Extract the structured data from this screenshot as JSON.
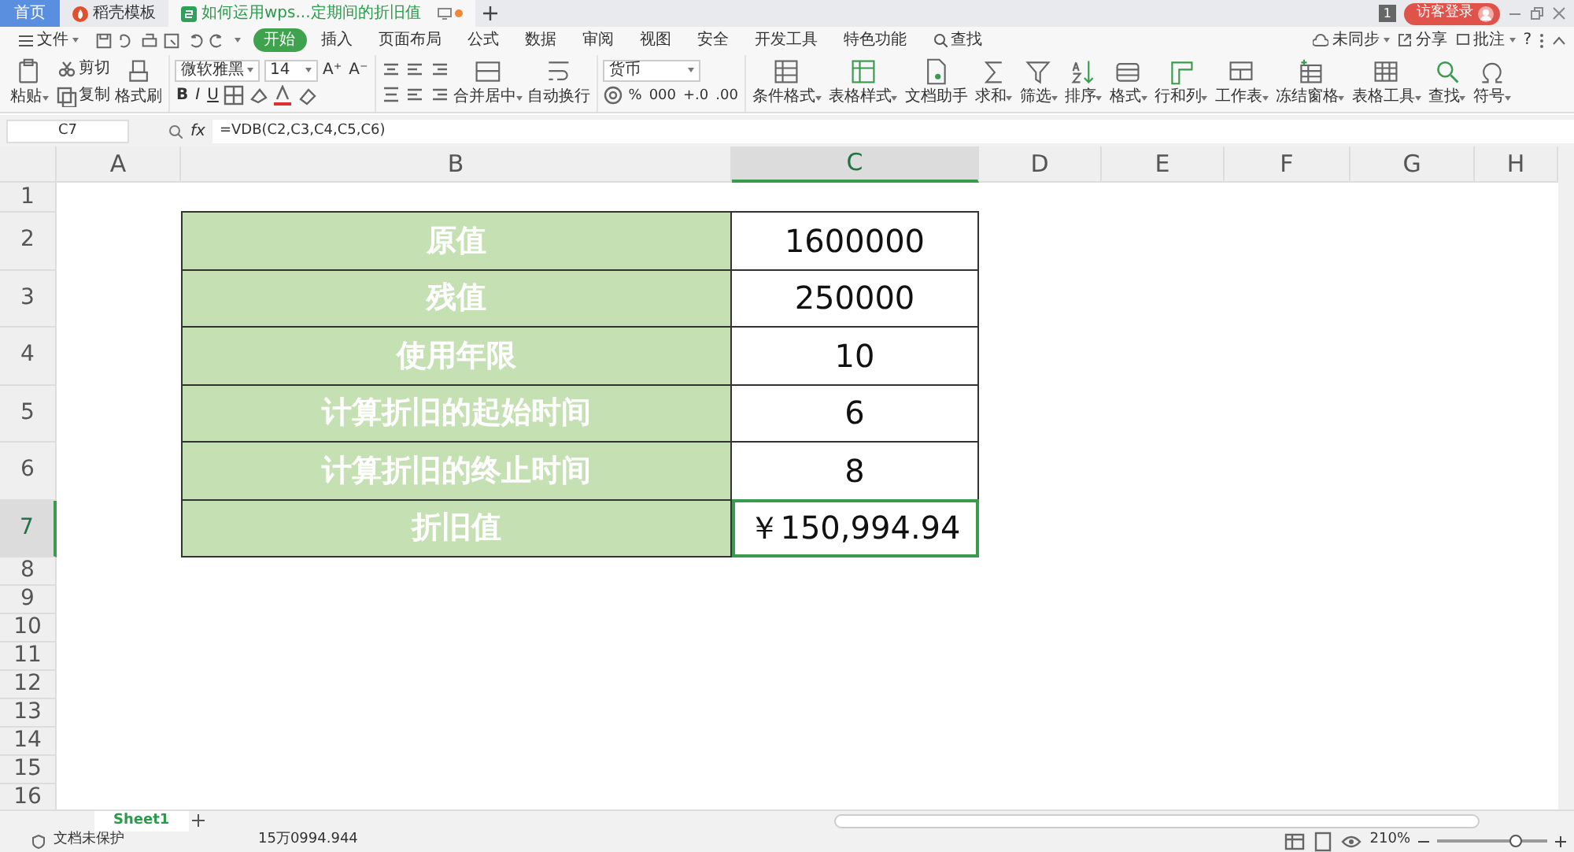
{
  "tabs": [
    {
      "label": "首页",
      "kind": "home",
      "selected": false
    },
    {
      "label": "稻壳模板",
      "kind": "template",
      "selected": false
    },
    {
      "label": "如何运用wps...定期间的折旧值",
      "kind": "sheet",
      "selected": true
    }
  ],
  "account": {
    "badge": "1",
    "login": "访客登录"
  },
  "menu": {
    "file": "文件",
    "tabs": [
      {
        "label": "开始",
        "selected": true
      },
      {
        "label": "插入",
        "selected": false
      },
      {
        "label": "页面布局",
        "selected": false
      },
      {
        "label": "公式",
        "selected": false
      },
      {
        "label": "数据",
        "selected": false
      },
      {
        "label": "审阅",
        "selected": false
      },
      {
        "label": "视图",
        "selected": false
      },
      {
        "label": "安全",
        "selected": false
      },
      {
        "label": "开发工具",
        "selected": false
      },
      {
        "label": "特色功能",
        "selected": false
      }
    ],
    "search": "查找",
    "sync": "未同步",
    "share": "分享",
    "comment": "批注",
    "help": "?"
  },
  "clipboard": {
    "paste": "粘贴",
    "cut": "剪切",
    "copy": "复制",
    "painter": "格式刷"
  },
  "font": {
    "name": "微软雅黑",
    "size": "14",
    "grow": "A⁺",
    "shrink": "A⁻",
    "styles": [
      "B",
      "I",
      "U"
    ]
  },
  "align": {
    "merge": "合并居中",
    "wrap": "自动换行"
  },
  "number": {
    "format": "货币",
    "buttons": [
      "%",
      "000",
      "+.0",
      ".00"
    ]
  },
  "tools": [
    {
      "label": "条件格式",
      "kind": "cond",
      "dropdown": true
    },
    {
      "label": "表格样式",
      "kind": "tablestyle",
      "dropdown": true
    },
    {
      "label": "文档助手",
      "kind": "doc",
      "dropdown": false
    },
    {
      "label": "求和",
      "kind": "sigma",
      "dropdown": true
    },
    {
      "label": "筛选",
      "kind": "funnel",
      "dropdown": true
    },
    {
      "label": "排序",
      "kind": "sort",
      "dropdown": true
    },
    {
      "label": "格式",
      "kind": "format",
      "dropdown": true
    },
    {
      "label": "行和列",
      "kind": "rowcol",
      "dropdown": true
    },
    {
      "label": "工作表",
      "kind": "sheet",
      "dropdown": true
    },
    {
      "label": "冻结窗格",
      "kind": "freeze",
      "dropdown": true
    },
    {
      "label": "表格工具",
      "kind": "tabletool",
      "dropdown": true
    },
    {
      "label": "查找",
      "kind": "search",
      "dropdown": true
    },
    {
      "label": "符号",
      "kind": "omega",
      "dropdown": true
    }
  ],
  "formula_bar": {
    "cell": "C7",
    "fx": "fx",
    "formula": "=VDB(C2,C3,C4,C5,C6)"
  },
  "sheet": {
    "columns": [
      {
        "label": "A",
        "selected": false
      },
      {
        "label": "B",
        "selected": false
      },
      {
        "label": "C",
        "selected": true
      },
      {
        "label": "D",
        "selected": false
      },
      {
        "label": "E",
        "selected": false
      },
      {
        "label": "F",
        "selected": false
      },
      {
        "label": "G",
        "selected": false
      },
      {
        "label": "H",
        "selected": false
      }
    ],
    "rows": [
      {
        "label": "1",
        "selected": false
      },
      {
        "label": "2",
        "selected": false,
        "name": "原值",
        "value": "1600000"
      },
      {
        "label": "3",
        "selected": false,
        "name": "残值",
        "value": "250000"
      },
      {
        "label": "4",
        "selected": false,
        "name": "使用年限",
        "value": "10"
      },
      {
        "label": "5",
        "selected": false,
        "name": "计算折旧的起始时间",
        "value": "6"
      },
      {
        "label": "6",
        "selected": false,
        "name": "计算折旧的终止时间",
        "value": "8"
      },
      {
        "label": "7",
        "selected": true,
        "name": "折旧值",
        "value": "￥150,994.94"
      },
      {
        "label": "8",
        "selected": false
      },
      {
        "label": "9",
        "selected": false
      },
      {
        "label": "10",
        "selected": false
      },
      {
        "label": "11",
        "selected": false
      },
      {
        "label": "12",
        "selected": false
      },
      {
        "label": "13",
        "selected": false
      },
      {
        "label": "14",
        "selected": false
      },
      {
        "label": "15",
        "selected": false
      },
      {
        "label": "16",
        "selected": false
      }
    ]
  },
  "sheet_tabs": [
    {
      "label": "Sheet1",
      "selected": true
    }
  ],
  "status_bar": {
    "protection": "文档未保护",
    "sum": "15万0994.944",
    "zoom": "210%",
    "level": 0.72
  }
}
